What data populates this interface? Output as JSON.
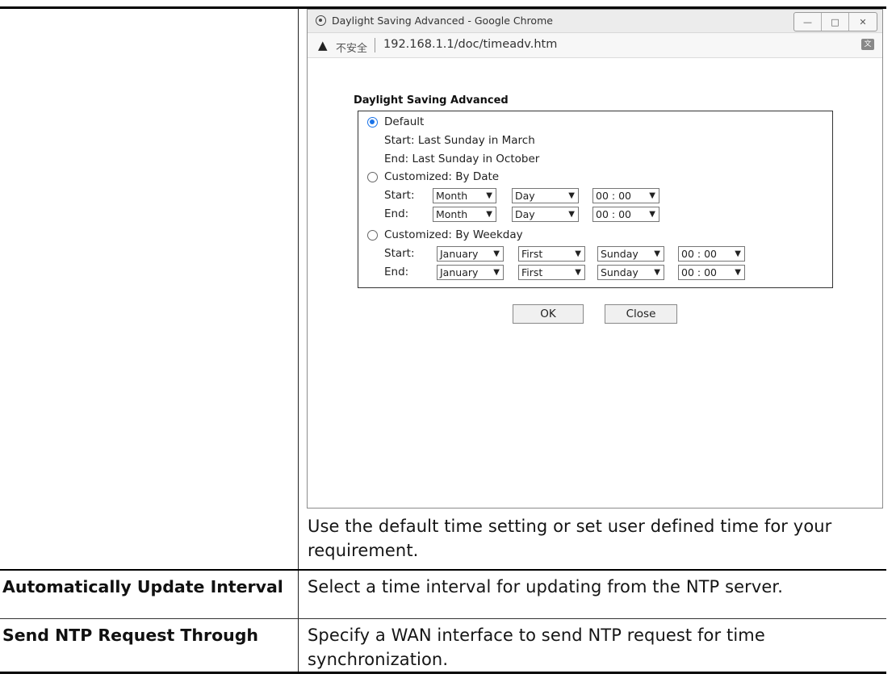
{
  "browser": {
    "window_title": "Daylight Saving Advanced - Google Chrome",
    "insecure_label": "不安全",
    "url": "192.168.1.1/doc/timeadv.htm",
    "window_buttons": [
      "—",
      "□",
      "✕"
    ]
  },
  "dialog": {
    "title": "Daylight Saving Advanced",
    "default": {
      "label": "Default",
      "selected": true,
      "start": "Start: Last Sunday in March",
      "end": "End: Last Sunday in October"
    },
    "by_date": {
      "label": "Customized: By Date",
      "selected": false,
      "start_label": "Start:",
      "end_label": "End:",
      "start": {
        "month": "Month",
        "day": "Day",
        "time": "00 : 00"
      },
      "end": {
        "month": "Month",
        "day": "Day",
        "time": "00 : 00"
      }
    },
    "by_weekday": {
      "label": "Customized: By Weekday",
      "selected": false,
      "start_label": "Start:",
      "end_label": "End:",
      "start": {
        "month": "January",
        "week": "First",
        "weekday": "Sunday",
        "time": "00 : 00"
      },
      "end": {
        "month": "January",
        "week": "First",
        "weekday": "Sunday",
        "time": "00 : 00"
      }
    },
    "ok_label": "OK",
    "close_label": "Close"
  },
  "table": {
    "row1_desc": "Use the default time setting or set user defined time for your requirement.",
    "row2_label": "Automatically Update Interval",
    "row2_desc": "Select a time interval for updating from the NTP server.",
    "row3_label": "Send NTP Request Through",
    "row3_desc": "Specify a WAN interface to send NTP request for time synchronization."
  }
}
